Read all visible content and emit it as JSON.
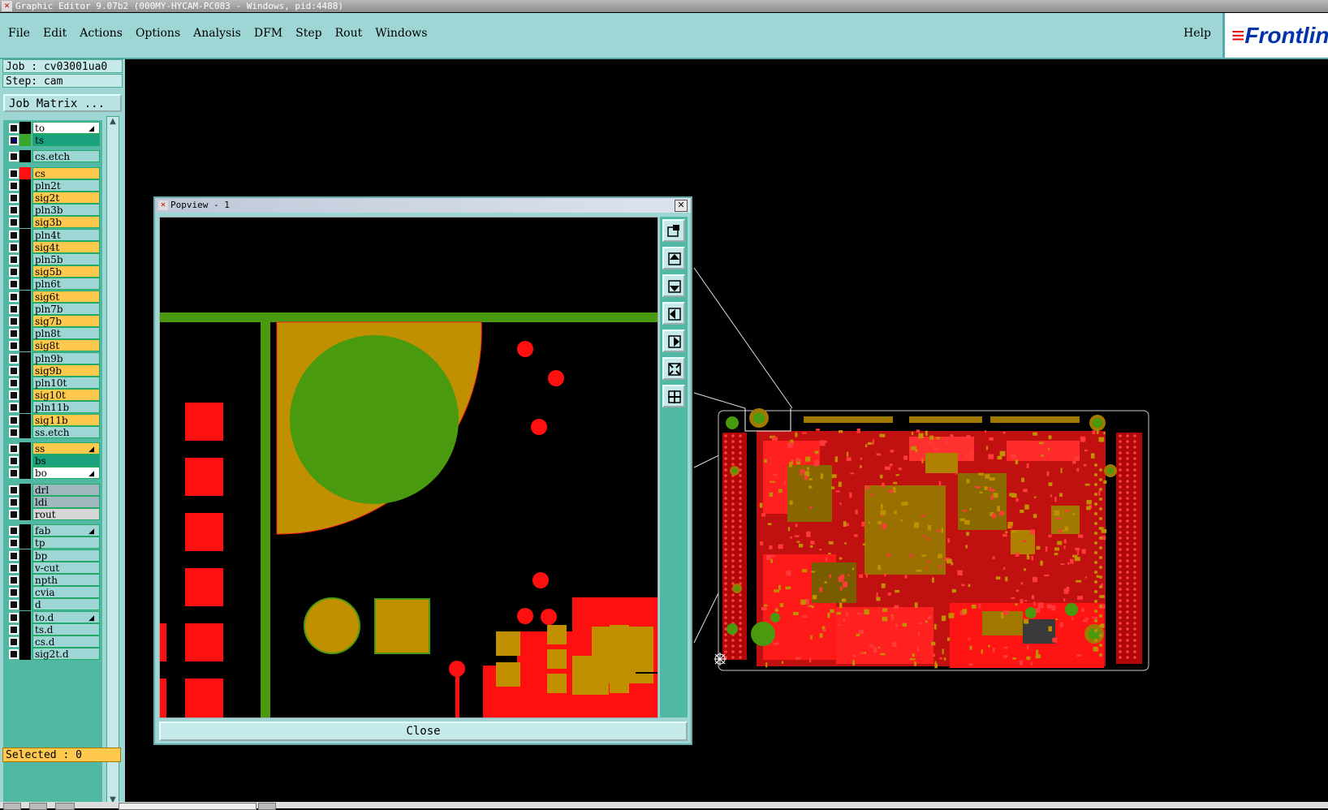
{
  "window": {
    "title": "Graphic Editor 9.07b2 (000MY-HYCAM-PC083 - Windows, pid:4488)"
  },
  "menubar": {
    "items": [
      "File",
      "Edit",
      "Actions",
      "Options",
      "Analysis",
      "DFM",
      "Step",
      "Rout",
      "Windows"
    ],
    "help": "Help",
    "logo": "Frontline"
  },
  "job": {
    "job_label": "Job : cv03001ua0",
    "step_label": "Step: cam",
    "matrix_button": "Job Matrix ..."
  },
  "layers": [
    {
      "name": "to",
      "color": "#ffffff",
      "arrow": true,
      "gap": false
    },
    {
      "name": "ts",
      "color": "#1aa27f",
      "swatch": "#3aa52a",
      "active": true,
      "gap": false
    },
    {
      "name": "cs.etch",
      "color": "#9ed6d6",
      "gap": true
    },
    {
      "name": "cs",
      "color": "#ffc94d",
      "swatch": "#ff1010",
      "gap": true
    },
    {
      "name": "pln2t",
      "color": "#9ed6d6"
    },
    {
      "name": "sig2t",
      "color": "#ffc94d"
    },
    {
      "name": "pln3b",
      "color": "#9ed6d6"
    },
    {
      "name": "sig3b",
      "color": "#ffc94d"
    },
    {
      "name": "pln4t",
      "color": "#9ed6d6"
    },
    {
      "name": "sig4t",
      "color": "#ffc94d"
    },
    {
      "name": "pln5b",
      "color": "#9ed6d6"
    },
    {
      "name": "sig5b",
      "color": "#ffc94d"
    },
    {
      "name": "pln6t",
      "color": "#9ed6d6"
    },
    {
      "name": "sig6t",
      "color": "#ffc94d"
    },
    {
      "name": "pln7b",
      "color": "#9ed6d6"
    },
    {
      "name": "sig7b",
      "color": "#ffc94d"
    },
    {
      "name": "pln8t",
      "color": "#9ed6d6"
    },
    {
      "name": "sig8t",
      "color": "#ffc94d"
    },
    {
      "name": "pln9b",
      "color": "#9ed6d6"
    },
    {
      "name": "sig9b",
      "color": "#ffc94d"
    },
    {
      "name": "pln10t",
      "color": "#9ed6d6"
    },
    {
      "name": "sig10t",
      "color": "#ffc94d"
    },
    {
      "name": "pln11b",
      "color": "#9ed6d6"
    },
    {
      "name": "sig11b",
      "color": "#ffc94d"
    },
    {
      "name": "ss.etch",
      "color": "#9ed6d6"
    },
    {
      "name": "ss",
      "color": "#ffc94d",
      "arrow": true,
      "gap": true
    },
    {
      "name": "bs",
      "color": "#1aa27f"
    },
    {
      "name": "bo",
      "color": "#ffffff",
      "arrow": true
    },
    {
      "name": "drl",
      "color": "#9fb7bf",
      "gap": true
    },
    {
      "name": "ldi",
      "color": "#9fb7bf"
    },
    {
      "name": "rout",
      "color": "#d6d6d6"
    },
    {
      "name": "fab",
      "color": "#9ed6d6",
      "arrow": true,
      "gap": true
    },
    {
      "name": "tp",
      "color": "#9ed6d6"
    },
    {
      "name": "bp",
      "color": "#9ed6d6"
    },
    {
      "name": "v-cut",
      "color": "#9ed6d6"
    },
    {
      "name": "npth",
      "color": "#9ed6d6"
    },
    {
      "name": "cvia",
      "color": "#9ed6d6"
    },
    {
      "name": "d",
      "color": "#9ed6d6"
    },
    {
      "name": "to.d",
      "color": "#9ed6d6",
      "arrow": true
    },
    {
      "name": "ts.d",
      "color": "#9ed6d6"
    },
    {
      "name": "cs.d",
      "color": "#9ed6d6"
    },
    {
      "name": "sig2t.d",
      "color": "#9ed6d6"
    }
  ],
  "status": {
    "selected": "Selected : 0"
  },
  "popview": {
    "title": "Popview - 1",
    "close_label": "Close",
    "tools": [
      "zoom-window-icon",
      "pan-up-icon",
      "pan-down-icon",
      "pan-left-icon",
      "pan-right-icon",
      "zoom-out-icon",
      "zoom-in-icon"
    ]
  },
  "colors": {
    "copper_red": "#ff1010",
    "pad_gold": "#c09000",
    "mask_green": "#4a9a10",
    "panel": "#9ed6d6",
    "layer_col": "#51b9a3"
  }
}
